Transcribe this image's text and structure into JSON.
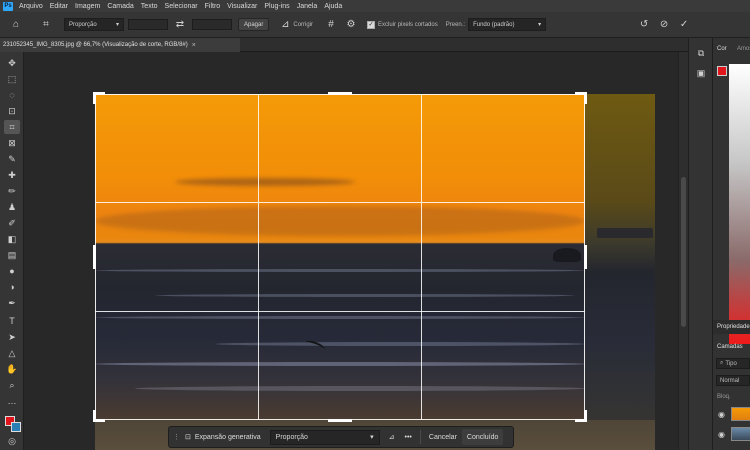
{
  "menu": {
    "logo": "Ps",
    "items": [
      "Arquivo",
      "Editar",
      "Imagem",
      "Camada",
      "Texto",
      "Selecionar",
      "Filtro",
      "Visualizar",
      "Plug-ins",
      "Janela",
      "Ajuda"
    ]
  },
  "options_bar": {
    "ratio_select": "Proporção",
    "clear_label": "Apagar",
    "straighten_label": "Corrigir",
    "delete_pixels_label": "Excluir pixels cortados",
    "fill_label": "Preen.:",
    "fill_select": "Fundo (padrão)"
  },
  "document": {
    "tab_title": "231052345_IMG_8305.jpg @ 66,7% (Visualização de corte, RGB/8#)",
    "close": "×"
  },
  "taskbar": {
    "generative_expand": "Expansão generativa",
    "ratio_select": "Proporção",
    "more": "•••",
    "cancel": "Cancelar",
    "done": "Concluído"
  },
  "panels": {
    "color_tab": "Cor",
    "swatches_tab": "Amostras",
    "properties_tab": "Propriedades",
    "layers_tab": "Camadas",
    "layer_search": "Tipo",
    "blend_mode": "Normal",
    "lock_label": "Bloq."
  },
  "colors": {
    "accent": "#31a8ff",
    "foreground": "#e0161c",
    "background_swatch": "#2a7fb5"
  },
  "icons": {
    "home": "home-icon",
    "crop": "crop-icon",
    "swap": "swap-icon",
    "grid": "grid-overlay-icon",
    "settings": "gear-icon",
    "reset": "reset-icon",
    "cancel": "cancel-icon",
    "commit": "check-icon"
  }
}
